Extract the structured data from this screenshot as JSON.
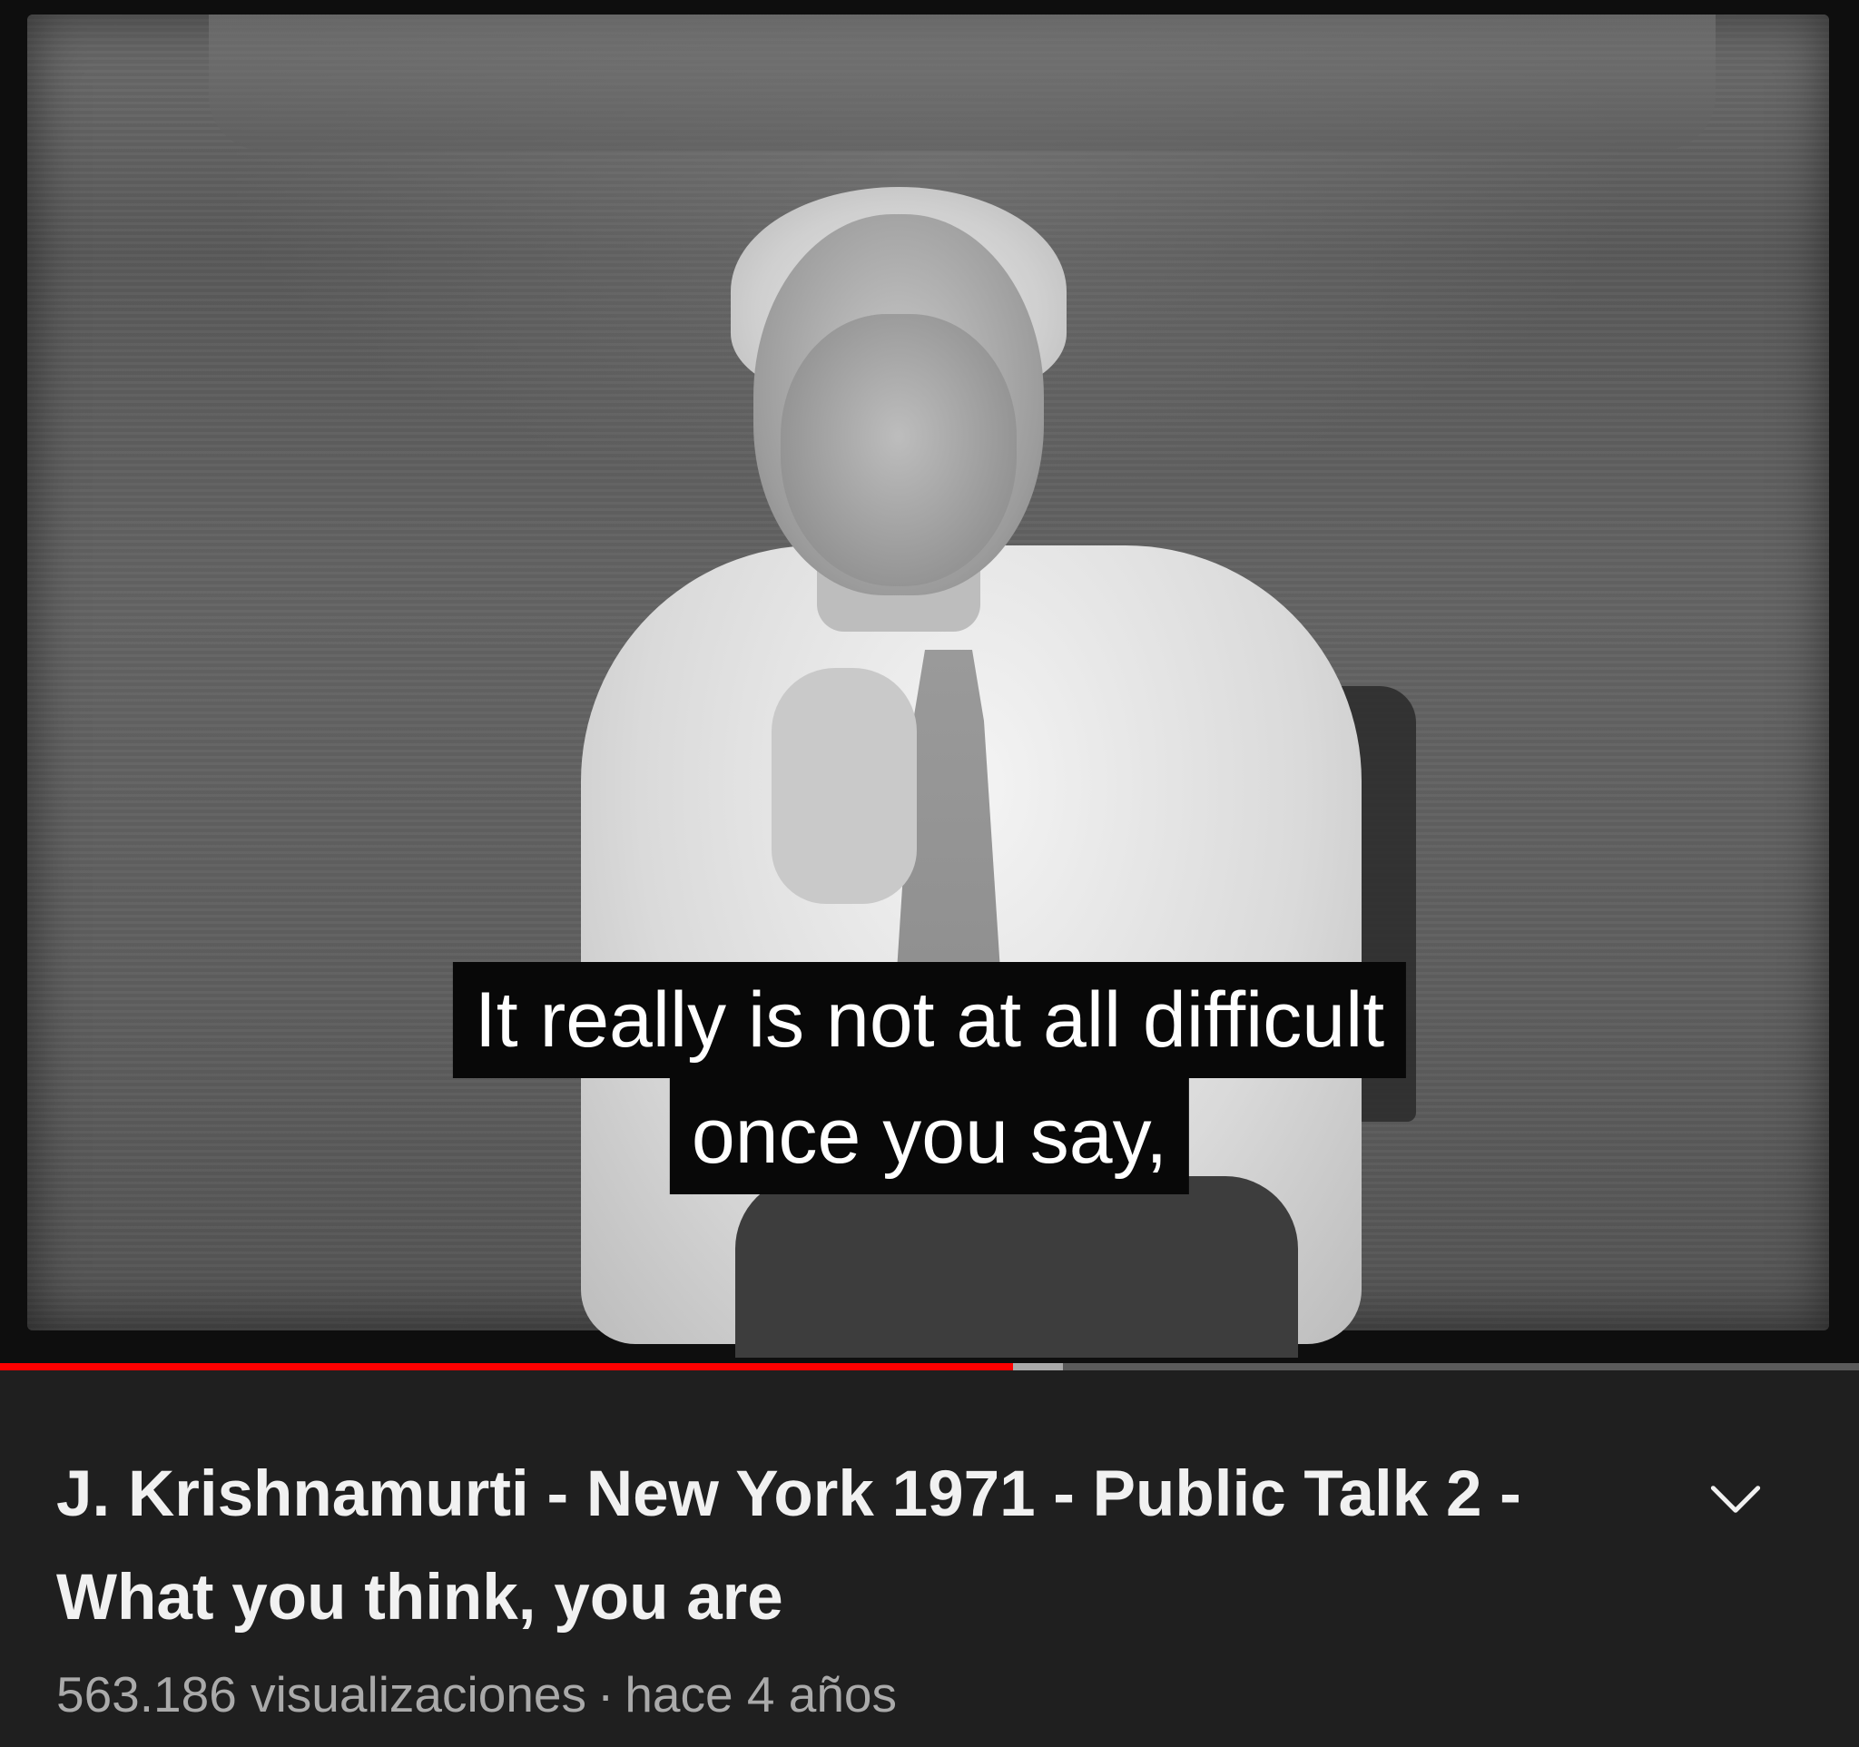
{
  "video": {
    "caption_lines": [
      "It really is not at all difficult",
      "once you say,"
    ],
    "progress": {
      "played_fraction": 0.545,
      "buffered_fraction": 0.572,
      "played_color": "#ff0000",
      "buffered_color": "#a9a9a9",
      "track_color": "#5a5a5a"
    }
  },
  "info": {
    "title": "J. Krishnamurti - New York 1971 - Public Talk 2 - What you think, you are",
    "views": "563.186 visualizaciones",
    "separator": "·",
    "age": "hace 4 años",
    "expand_icon": "chevron-down-icon"
  }
}
